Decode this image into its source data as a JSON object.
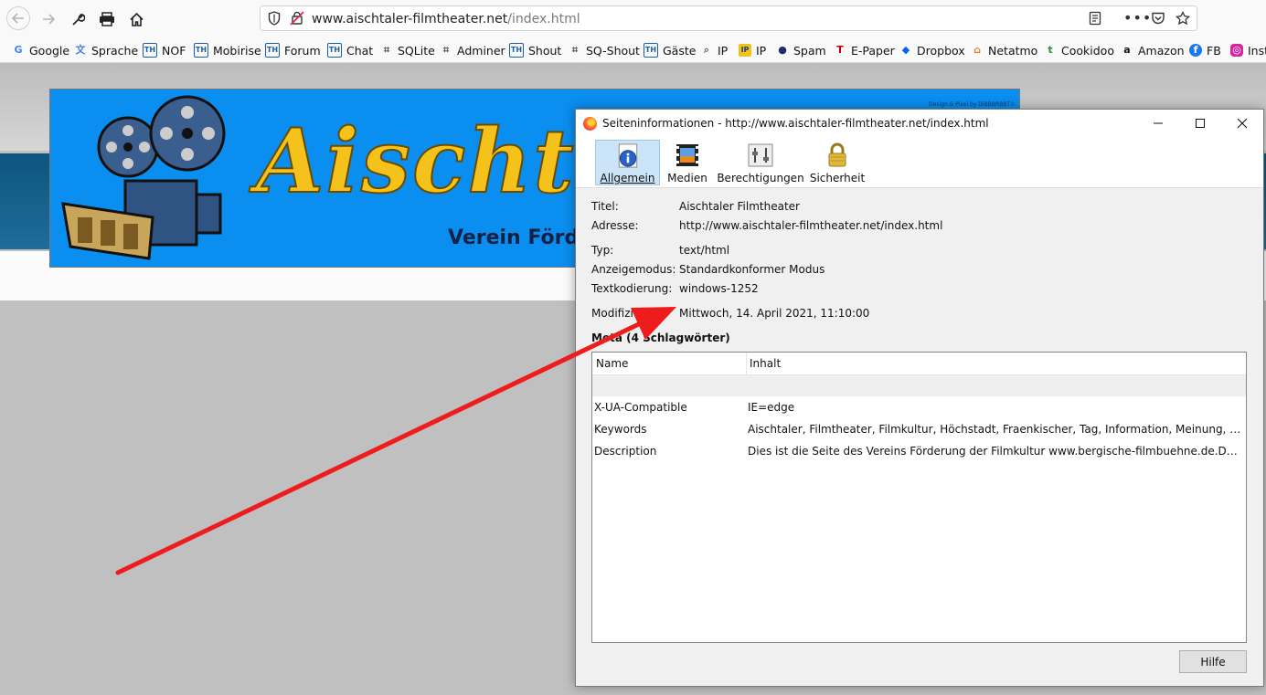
{
  "browser": {
    "url_host": "www.aischtaler-filmtheater.net",
    "url_path": "/index.html"
  },
  "bookmarks": [
    {
      "label": "Google",
      "icon": "google-icon",
      "color": "#4285f4"
    },
    {
      "label": "Sprache",
      "icon": "translate-icon",
      "color": "#4a7fd6"
    },
    {
      "label": "NOF",
      "icon": "th-icon",
      "color": "#1a5fa8"
    },
    {
      "label": "Mobirise",
      "icon": "th-icon",
      "color": "#1a5fa8"
    },
    {
      "label": "Forum",
      "icon": "th-icon",
      "color": "#1a5fa8"
    },
    {
      "label": "Chat",
      "icon": "th-icon",
      "color": "#1a5fa8"
    },
    {
      "label": "SQLite",
      "icon": "db-icon",
      "color": "#555555"
    },
    {
      "label": "Adminer",
      "icon": "db-icon",
      "color": "#555555"
    },
    {
      "label": "Shout",
      "icon": "th-icon",
      "color": "#1a5fa8"
    },
    {
      "label": "SQ-Shout",
      "icon": "db-icon",
      "color": "#555555"
    },
    {
      "label": "Gäste",
      "icon": "th-icon",
      "color": "#1a5fa8"
    },
    {
      "label": "IP",
      "icon": "magnifier-icon",
      "color": "#666666"
    },
    {
      "label": "IP",
      "icon": "ip-icon",
      "color": "#1a3f8a"
    },
    {
      "label": "Spam",
      "icon": "spam-icon",
      "color": "#1a2f6a"
    },
    {
      "label": "E-Paper",
      "icon": "epaper-icon",
      "color": "#c00000"
    },
    {
      "label": "Dropbox",
      "icon": "dropbox-icon",
      "color": "#0061fe"
    },
    {
      "label": "Netatmo",
      "icon": "netatmo-icon",
      "color": "#f07a1a"
    },
    {
      "label": "Cookidoo",
      "icon": "cookidoo-icon",
      "color": "#2e8b3a"
    },
    {
      "label": "Amazon",
      "icon": "amazon-icon",
      "color": "#111111"
    },
    {
      "label": "FB",
      "icon": "facebook-icon",
      "color": "#1877f2"
    },
    {
      "label": "Inst",
      "icon": "instagram-icon",
      "color": "#d6249f"
    }
  ],
  "banner": {
    "title": "Aischtaler",
    "subtitle": "Verein Förder",
    "credit": "Design & Pixel by DiBBBRBBT©"
  },
  "dialog": {
    "title": "Seiteninformationen - http://www.aischtaler-filmtheater.net/index.html",
    "tabs": [
      {
        "label": "Allgemein",
        "icon": "info-icon",
        "active": true
      },
      {
        "label": "Medien",
        "icon": "media-icon",
        "active": false
      },
      {
        "label": "Berechtigungen",
        "icon": "permissions-icon",
        "active": false
      },
      {
        "label": "Sicherheit",
        "icon": "lock-icon",
        "active": false
      }
    ],
    "fields": {
      "title_label": "Titel:",
      "title_value": "Aischtaler Filmtheater",
      "address_label": "Adresse:",
      "address_value": "http://www.aischtaler-filmtheater.net/index.html",
      "type_label": "Typ:",
      "type_value": "text/html",
      "mode_label": "Anzeigemodus:",
      "mode_value": "Standardkonformer Modus",
      "encoding_label": "Textkodierung:",
      "encoding_value": "windows-1252",
      "modified_label": "Modifiziert:",
      "modified_value": "Mittwoch, 14. April 2021, 11:10:00"
    },
    "meta_heading": "Meta (4 Schlagwörter)",
    "meta_columns": [
      "Name",
      "Inhalt"
    ],
    "meta_rows": [
      {
        "name": "X-UA-Compatible",
        "value": "IE=edge"
      },
      {
        "name": "Keywords",
        "value": "Aischtaler, Filmtheater, Filmkultur, Höchstadt, Fraenkischer, Tag, Information, Meinung, Unterdrueckung"
      },
      {
        "name": "Description",
        "value": "Dies ist die Seite des Vereins Förderung der Filmkultur www.bergische-filmbuehne.de.Der Schutz unserer"
      }
    ],
    "help_button": "Hilfe"
  },
  "annotation": {
    "color": "#ee1c1c"
  }
}
